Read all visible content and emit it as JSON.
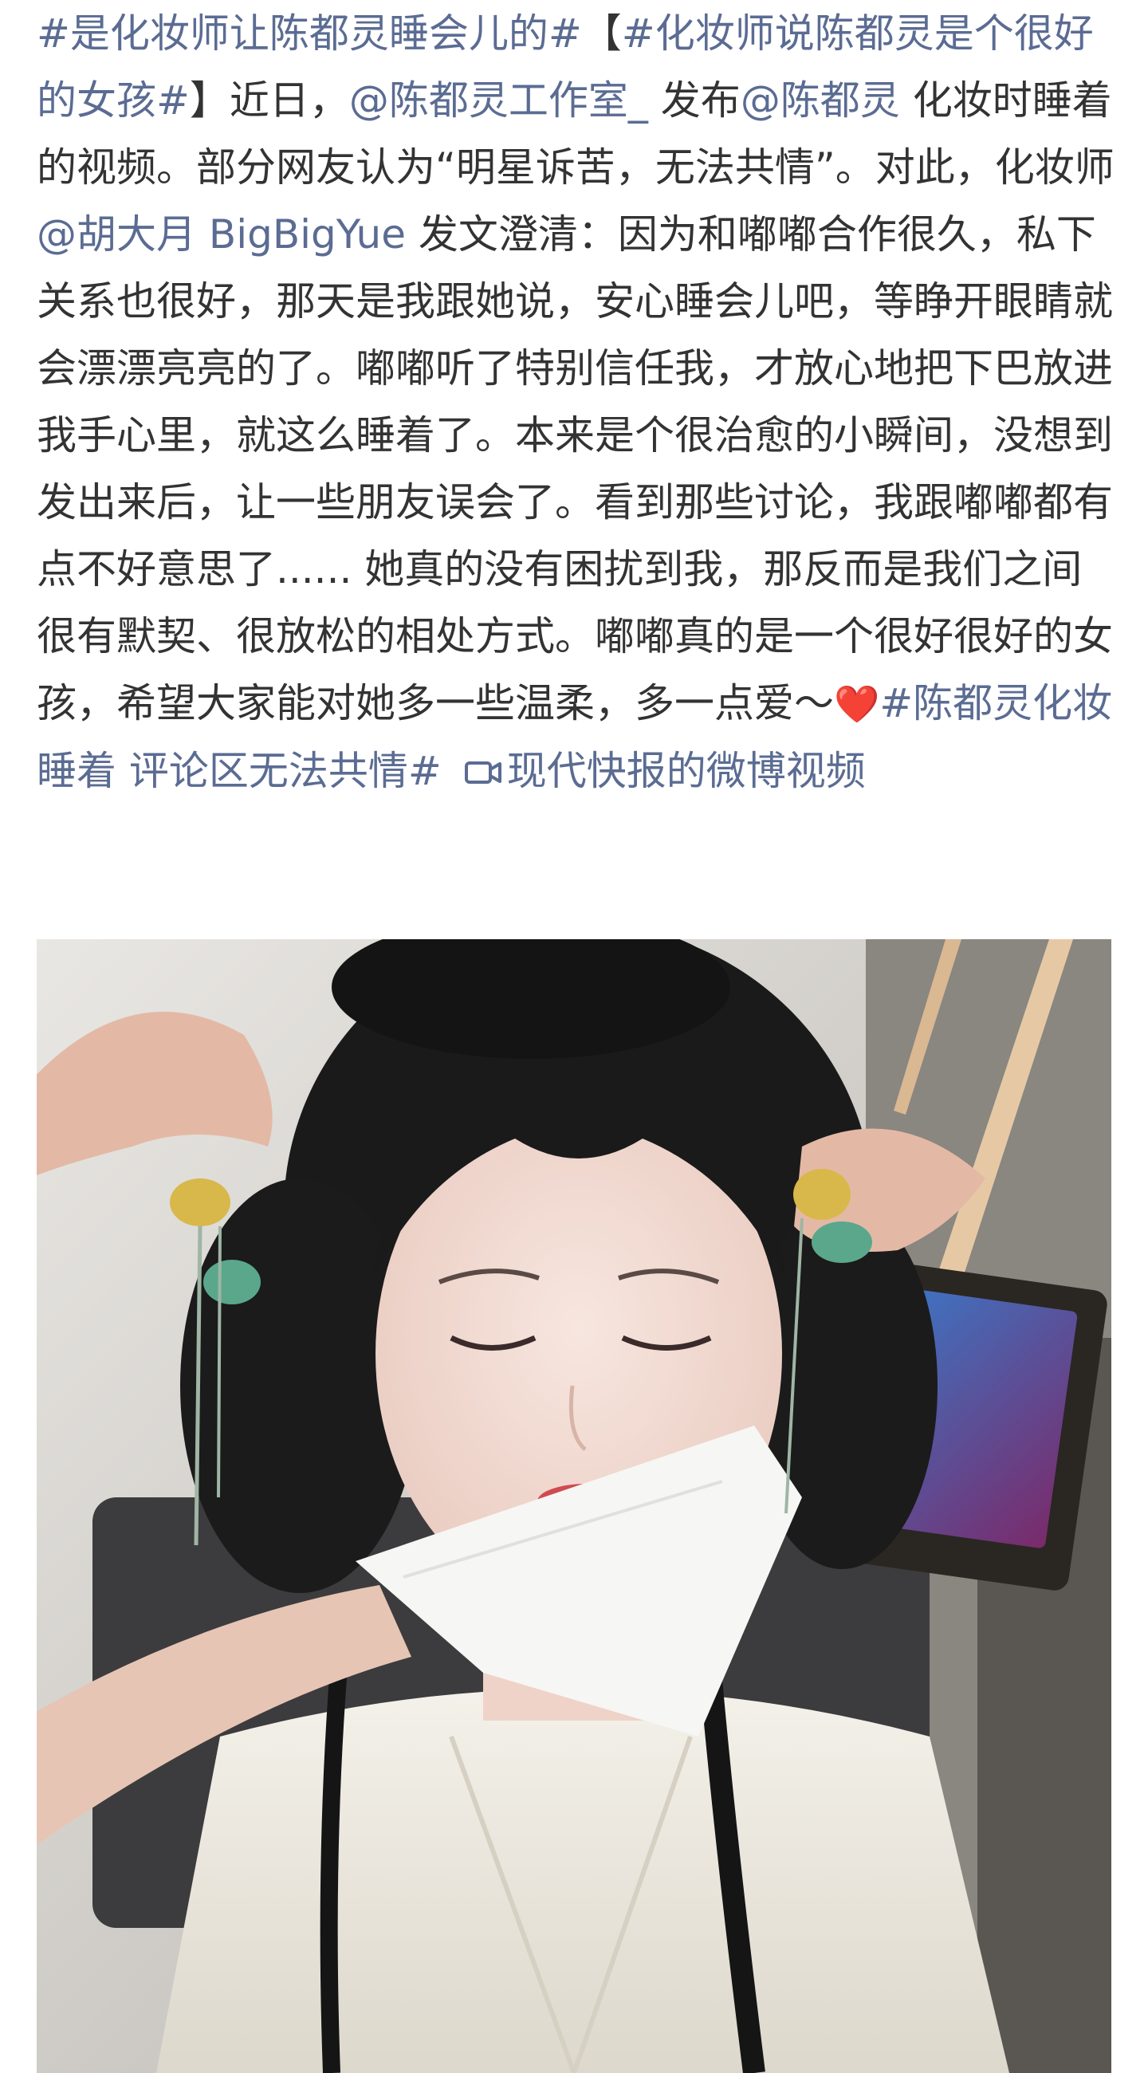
{
  "post": {
    "segments": [
      {
        "text": "#是化妆师让陈都灵睡会儿的#",
        "kind": "link",
        "name": "topic-tag-sleep"
      },
      {
        "text": "【",
        "kind": "plain",
        "name": "bracket-open"
      },
      {
        "text": "#化妆师说陈都灵是个很好的女孩#",
        "kind": "link",
        "name": "topic-tag-good-girl"
      },
      {
        "text": "】近日，",
        "kind": "plain",
        "name": "text-recent"
      },
      {
        "text": "@陈都灵工作室_",
        "kind": "link",
        "name": "mention-studio"
      },
      {
        "text": " 发布",
        "kind": "plain",
        "name": "text-publish"
      },
      {
        "text": "@陈都灵",
        "kind": "link",
        "name": "mention-chen-duling"
      },
      {
        "text": " 化妆时睡着的视频。部分网友认为“明星诉苦，无法共情”。对此，化妆师",
        "kind": "plain",
        "name": "text-body-1"
      },
      {
        "text": "@胡大月 BigBigYue",
        "kind": "link",
        "name": "mention-makeup-artist"
      },
      {
        "text": " 发文澄清：因为和嘟嘟合作很久，私下关系也很好，那天是我跟她说，安心睡会儿吧，等睁开眼睛就会漂漂亮亮的了。嘟嘟听了特别信任我，才放心地把下巴放进我手心里，就这么睡着了。本来是个很治愈的小瞬间，没想到发出来后，让一些朋友误会了。看到那些讨论，我跟嘟嘟都有点不好意思了...... 她真的没有困扰到我，那反而是我们之间很有默契、很放松的相处方式。嘟嘟真的是一个很好很好的女孩，希望大家能对她多一些温柔，多一点爱～",
        "kind": "plain",
        "name": "text-body-2"
      },
      {
        "text": "❤️",
        "kind": "heart",
        "name": "heart-emoji"
      },
      {
        "text": "#陈都灵化妆睡着 评论区无法共情#",
        "kind": "link",
        "name": "topic-tag-comments"
      }
    ],
    "video_link": {
      "icon": "video-camera-icon",
      "text": "现代快报的微博视频"
    }
  },
  "media": {
    "type": "photo",
    "description_icon": "photo-image"
  },
  "colors": {
    "link": "#5b6c93",
    "text": "#333333",
    "heart": "#e3242b",
    "background": "#ffffff"
  }
}
